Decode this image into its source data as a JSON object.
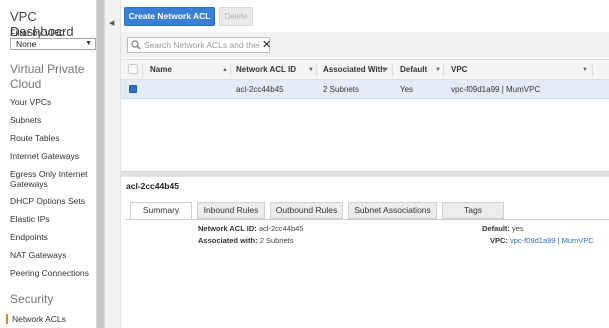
{
  "sidebar": {
    "title": "VPC Dashboard",
    "filter_label": "Filter by VPC:",
    "filter_value": "None",
    "section_vpc": "Virtual Private Cloud",
    "items": [
      "Your VPCs",
      "Subnets",
      "Route Tables",
      "Internet Gateways",
      "Egress Only Internet Gateways",
      "DHCP Options Sets",
      "Elastic IPs",
      "Endpoints",
      "NAT Gateways",
      "Peering Connections"
    ],
    "section_security": "Security",
    "active_item": "Network ACLs"
  },
  "toolbar": {
    "create_label": "Create Network ACL",
    "delete_label": "Delete"
  },
  "search": {
    "placeholder": "Search Network ACLs and their p"
  },
  "table": {
    "columns": [
      "Name",
      "Network ACL ID",
      "Associated With",
      "Default",
      "VPC"
    ],
    "rows": [
      {
        "name": "",
        "acl_id": "acl-2cc44b45",
        "associated": "2 Subnets",
        "default": "Yes",
        "vpc": "vpc-f09d1a99 | MumVPC"
      }
    ]
  },
  "details": {
    "title": "acl-2cc44b45",
    "tabs": [
      "Summary",
      "Inbound Rules",
      "Outbound Rules",
      "Subnet Associations",
      "Tags"
    ],
    "active_tab": "Summary",
    "fields": {
      "acl_id_label": "Network ACL ID:",
      "acl_id_value": "acl-2cc44b45",
      "assoc_label": "Associated with:",
      "assoc_value": "2 Subnets",
      "default_label": "Default:",
      "default_value": "yes",
      "vpc_label": "VPC:",
      "vpc_value": "vpc-f09d1a99 | MumVPC"
    }
  },
  "colors": {
    "primary_button": "#3a7fd6",
    "selected_row": "#e2ecf7",
    "active_marker": "#e8890c",
    "link": "#2f6fc6"
  }
}
